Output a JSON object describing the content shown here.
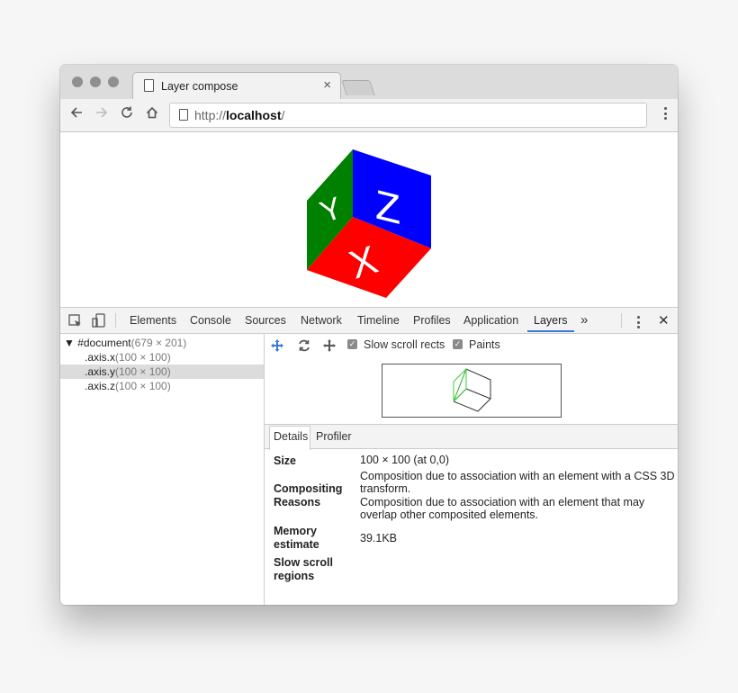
{
  "browser": {
    "tab_title": "Layer compose",
    "tab_close": "×",
    "url_scheme": "http://",
    "url_host": "localhost",
    "url_path": "/",
    "icons": {
      "back": "arrow-left-icon",
      "forward": "arrow-right-icon",
      "reload": "reload-icon",
      "home": "home-icon",
      "menu": "kebab-menu-icon",
      "page": "page-icon"
    }
  },
  "cube": {
    "faces": [
      {
        "label": "Y",
        "color": "#008000"
      },
      {
        "label": "Z",
        "color": "#0000ff"
      },
      {
        "label": "X",
        "color": "#ff0000"
      }
    ]
  },
  "devtools": {
    "tabs": [
      "Elements",
      "Console",
      "Sources",
      "Network",
      "Timeline",
      "Profiles",
      "Application",
      "Layers"
    ],
    "active_tab": "Layers",
    "overflow": "»",
    "close": "✕",
    "accent": "#3879d9"
  },
  "layer_tree": [
    {
      "name": "▼ #document",
      "size": "(679 × 201)"
    },
    {
      "name": ".axis.x",
      "size": "(100 × 100)"
    },
    {
      "name": ".axis.y",
      "size": "(100 × 100)"
    },
    {
      "name": ".axis.z",
      "size": "(100 × 100)"
    }
  ],
  "layer_toolbar": {
    "slow_scroll_rects": "Slow scroll rects",
    "paints": "Paints"
  },
  "details": {
    "tabs": [
      "Details",
      "Profiler"
    ],
    "size_label": "Size",
    "size_value": "100 × 100 (at 0,0)",
    "compositing_label_1": "Compositing",
    "compositing_label_2": "Reasons",
    "compositing_value_1": "Composition due to association with an element with a CSS 3D",
    "compositing_value_2": "transform.",
    "compositing_value_3": "Composition due to association with an element that may",
    "compositing_value_4": "overlap other composited elements.",
    "memory_label_1": "Memory",
    "memory_label_2": "estimate",
    "memory_value": "39.1KB",
    "slow_scroll_label_1": "Slow scroll",
    "slow_scroll_label_2": "regions"
  }
}
